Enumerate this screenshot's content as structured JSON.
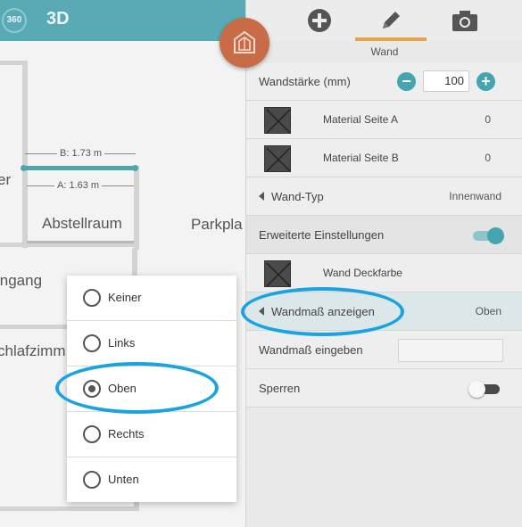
{
  "topbar": {
    "view_360_label": "360",
    "view_3d_label": "3D"
  },
  "plan": {
    "rooms": [
      "er",
      "Abstellraum",
      "Parkpla",
      "ingang",
      "chlafzimm"
    ],
    "dimension_b": "B: 1.73 m",
    "dimension_a": "A: 1.63 m"
  },
  "panel": {
    "tabs": [
      "add-icon",
      "pencil-icon",
      "camera-icon"
    ],
    "active_tab": "pencil-icon",
    "title": "Wand",
    "wall_thickness_label": "Wandstärke (mm)",
    "wall_thickness_value": "100",
    "material_a_label": "Material Seite A",
    "material_a_value": "0",
    "material_b_label": "Material Seite B",
    "material_b_value": "0",
    "wall_type_label": "Wand-Typ",
    "wall_type_value": "Innenwand",
    "advanced_label": "Erweiterte Einstellungen",
    "advanced_on": true,
    "cover_color_label": "Wand Deckfarbe",
    "show_dimension_label": "Wandmaß anzeigen",
    "show_dimension_value": "Oben",
    "enter_dimension_label": "Wandmaß eingeben",
    "enter_dimension_value": "",
    "lock_label": "Sperren",
    "lock_on": false
  },
  "menu": {
    "options": [
      "Keiner",
      "Links",
      "Oben",
      "Rechts",
      "Unten"
    ],
    "selected": "Oben"
  },
  "colors": {
    "accent": "#44a5b1",
    "fab": "#c86b47",
    "tab_underline": "#e2a54f",
    "annotation": "#19a3e0"
  }
}
